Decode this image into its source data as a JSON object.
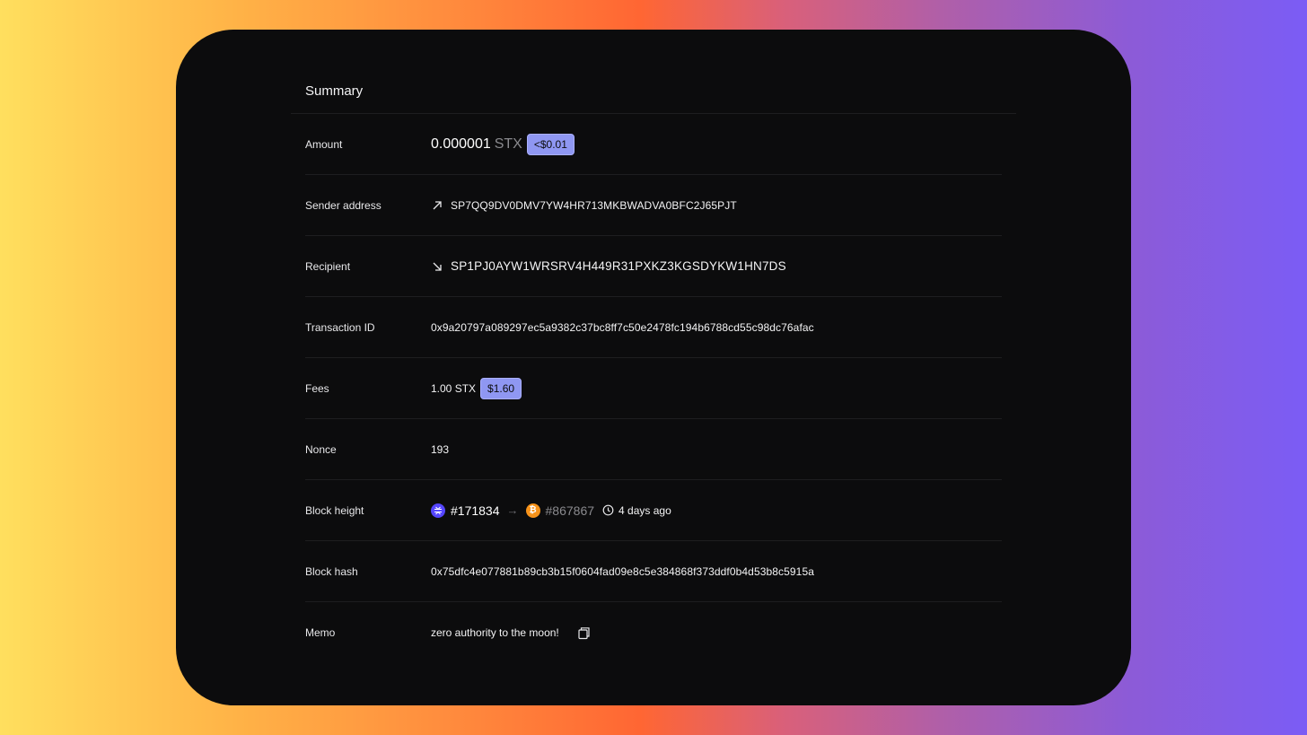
{
  "summary": {
    "title": "Summary"
  },
  "rows": {
    "amount": {
      "label": "Amount",
      "value": "0.000001",
      "unit": "STX",
      "usd": "<$0.01"
    },
    "sender": {
      "label": "Sender address",
      "value": "SP7QQ9DV0DMV7YW4HR713MKBWADVA0BFC2J65PJT",
      "icon": "arrow-up-right-icon"
    },
    "recipient": {
      "label": "Recipient",
      "value": "SP1PJ0AYW1WRSRV4H449R31PXKZ3KGSDYKW1HN7DS",
      "icon": "arrow-down-right-icon"
    },
    "txid": {
      "label": "Transaction ID",
      "value": "0x9a20797a089297ec5a9382c37bc8ff7c50e2478fc194b6788cd55c98dc76afac"
    },
    "fees": {
      "label": "Fees",
      "value": "1.00 STX",
      "usd": "$1.60"
    },
    "nonce": {
      "label": "Nonce",
      "value": "193"
    },
    "block_height": {
      "label": "Block height",
      "stacks_block": "#171834",
      "btc_block": "#867867",
      "time": "4 days ago"
    },
    "block_hash": {
      "label": "Block hash",
      "value": "0x75dfc4e077881b89cb3b15f0604fad09e8c5e384868f373ddf0b4d53b8c5915a"
    },
    "memo": {
      "label": "Memo",
      "value": "zero authority to the moon!",
      "icon": "copy-icon"
    }
  },
  "colors": {
    "card_bg": "#0c0c0d",
    "badge_bg": "#8f97f2",
    "stacks_accent": "#5546ff",
    "bitcoin_accent": "#f7931a"
  }
}
